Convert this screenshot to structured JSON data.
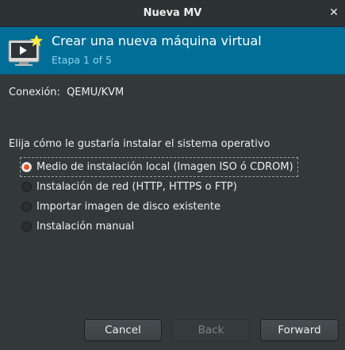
{
  "window": {
    "title": "Nueva MV"
  },
  "header": {
    "title": "Crear una nueva máquina virtual",
    "subtitle": "Etapa 1 of 5",
    "icon": "vm-monitor-star-icon"
  },
  "connection": {
    "label": "Conexión:",
    "value": "QEMU/KVM"
  },
  "install": {
    "prompt": "Elija cómo le gustaría instalar el sistema operativo",
    "options": [
      {
        "label": "Medio de instalación local (Imagen ISO ó CDROM)",
        "selected": true
      },
      {
        "label": "Instalación de red (HTTP, HTTPS o FTP)",
        "selected": false
      },
      {
        "label": "Importar imagen de disco existente",
        "selected": false
      },
      {
        "label": "Instalación manual",
        "selected": false
      }
    ]
  },
  "buttons": {
    "cancel": "Cancel",
    "back": "Back",
    "forward": "Forward"
  },
  "colors": {
    "header_bg": "#006e96",
    "accent": "#e95420",
    "window_bg": "#33393b"
  }
}
